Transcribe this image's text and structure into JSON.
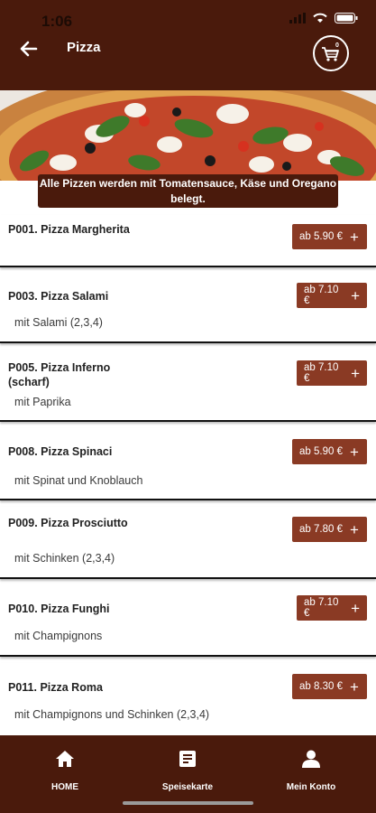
{
  "status_bar": {
    "time": "1:06"
  },
  "header": {
    "title": "Pizza",
    "cart_count": "0"
  },
  "banner": {
    "text": "Alle Pizzen werden mit Tomatensauce, Käse und Oregano belegt."
  },
  "items": [
    {
      "name": "P001. Pizza Margherita",
      "desc": "",
      "price": "ab 5.90 €"
    },
    {
      "name": "P003. Pizza Salami",
      "desc": "mit Salami (2,3,4)",
      "price": "ab 7.10 €"
    },
    {
      "name": "P005. Pizza Inferno (scharf)",
      "desc": "mit Paprika",
      "price": "ab 7.10 €"
    },
    {
      "name": "P008. Pizza Spinaci",
      "desc": "mit Spinat und Knoblauch",
      "price": "ab 5.90 €"
    },
    {
      "name": "P009. Pizza Prosciutto",
      "desc": "mit Schinken (2,3,4)",
      "price": "ab 7.80 €"
    },
    {
      "name": "P010. Pizza Funghi",
      "desc": "mit Champignons",
      "price": "ab 7.10 €"
    },
    {
      "name": "P011. Pizza Roma",
      "desc": "mit Champignons und Schinken (2,3,4)",
      "price": "ab 8.30 €"
    }
  ],
  "price_button": {
    "plus": "+"
  },
  "nav": {
    "home": "HOME",
    "menu": "Speisekarte",
    "account": "Mein Konto"
  },
  "colors": {
    "primary": "#4a1a0c",
    "price_button": "#8a3a24"
  }
}
